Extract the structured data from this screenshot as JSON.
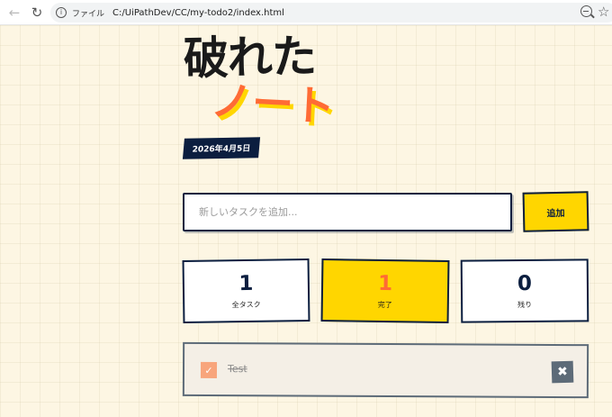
{
  "browser": {
    "scheme_label": "ファイル",
    "url": "C:/UiPathDev/CC/my-todo2/index.html",
    "icons": {
      "back": "back-arrow-icon",
      "reload": "reload-icon",
      "info": "info-icon",
      "zoom": "zoom-out-icon",
      "bookmark": "star-icon"
    }
  },
  "app": {
    "title_line1": "破れた",
    "title_line2": "ノート",
    "date": "2026年4月5日",
    "colors": {
      "navy": "#0b1e3f",
      "yellow": "#ffd600",
      "orange": "#ff6b35",
      "paper": "#fdf6e3"
    }
  },
  "input": {
    "placeholder": "新しいタスクを追加...",
    "value": "",
    "add_label": "追加"
  },
  "stats": [
    {
      "value": "1",
      "label": "全タスク"
    },
    {
      "value": "1",
      "label": "完了"
    },
    {
      "value": "0",
      "label": "残り"
    }
  ],
  "tasks": [
    {
      "text": "Test",
      "done": true,
      "check_glyph": "✓",
      "delete_glyph": "✖"
    }
  ]
}
